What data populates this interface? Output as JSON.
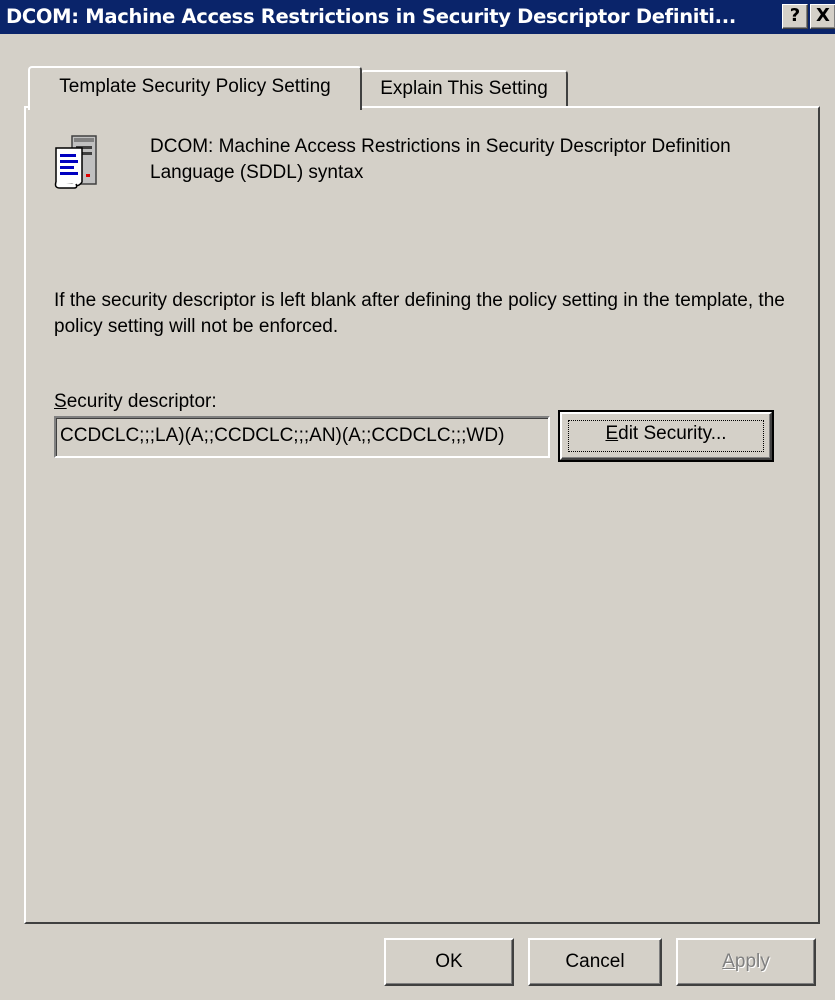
{
  "window": {
    "title": "DCOM: Machine Access Restrictions in Security Descriptor Definiti...",
    "help_button": "?",
    "close_button": "X"
  },
  "tabs": [
    {
      "label": "Template Security Policy Setting",
      "active": true
    },
    {
      "label": "Explain This Setting",
      "active": false
    }
  ],
  "policy": {
    "icon": "policy-document-icon",
    "title": "DCOM: Machine Access Restrictions in Security Descriptor Definition Language (SDDL) syntax"
  },
  "info_text": "If the security descriptor is left blank after defining the policy setting in the template, the policy setting will not be enforced.",
  "security_descriptor": {
    "label_underlined": "S",
    "label_rest": "ecurity descriptor:",
    "value": "CCDCLC;;;LA)(A;;CCDCLC;;;AN)(A;;CCDCLC;;;WD)",
    "edit_button_underlined": "E",
    "edit_button_rest": "dit Security..."
  },
  "buttons": {
    "ok": "OK",
    "cancel": "Cancel",
    "apply_underlined": "A",
    "apply_rest": "pply",
    "apply_enabled": false
  },
  "colors": {
    "titlebar": "#0a246a",
    "face": "#d4d0c8",
    "disabled_text": "#808080"
  }
}
